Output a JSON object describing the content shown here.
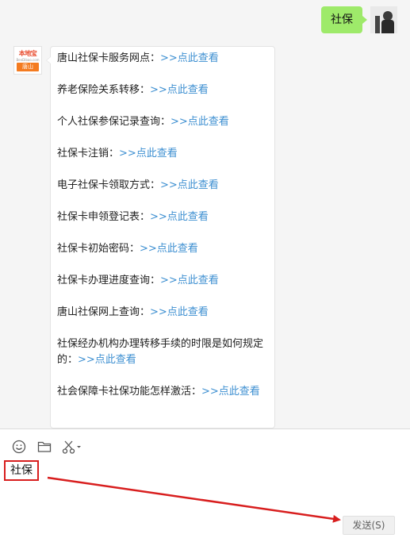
{
  "chat": {
    "outgoing_message": "社保",
    "bot_avatar": {
      "logo_text": "本地宝",
      "logo_subtext": "BenDibao.com",
      "city": "唐山"
    },
    "items": [
      {
        "label": "唐山社保卡服务网点：",
        "link": ">>点此查看"
      },
      {
        "label": "养老保险关系转移：",
        "link": ">>点此查看"
      },
      {
        "label": "个人社保参保记录查询：",
        "link": ">>点此查看"
      },
      {
        "label": "社保卡注销：",
        "link": ">>点此查看"
      },
      {
        "label": "电子社保卡领取方式：",
        "link": ">>点此查看"
      },
      {
        "label": "社保卡申领登记表：",
        "link": ">>点此查看"
      },
      {
        "label": "社保卡初始密码：",
        "link": ">>点此查看"
      },
      {
        "label": "社保卡办理进度查询：",
        "link": ">>点此查看"
      },
      {
        "label": "唐山社保网上查询：",
        "link": ">>点此查看"
      },
      {
        "label": "社保经办机构办理转移手续的时限是如何规定的：",
        "link": ">>点此查看"
      },
      {
        "label": "社会保障卡社保功能怎样激活：",
        "link": ">>点此查看"
      }
    ]
  },
  "toolbar": {
    "icons": [
      "emoji-icon",
      "folder-icon",
      "scissors-icon",
      "chevron-down-icon"
    ]
  },
  "input": {
    "value": "社保"
  },
  "send_button": {
    "label": "发送(S)"
  },
  "colors": {
    "outgoing_bubble": "#9eea6a",
    "link": "#3d8fd1",
    "annotation": "#d81e1e",
    "logo_orange": "#f47b20"
  }
}
